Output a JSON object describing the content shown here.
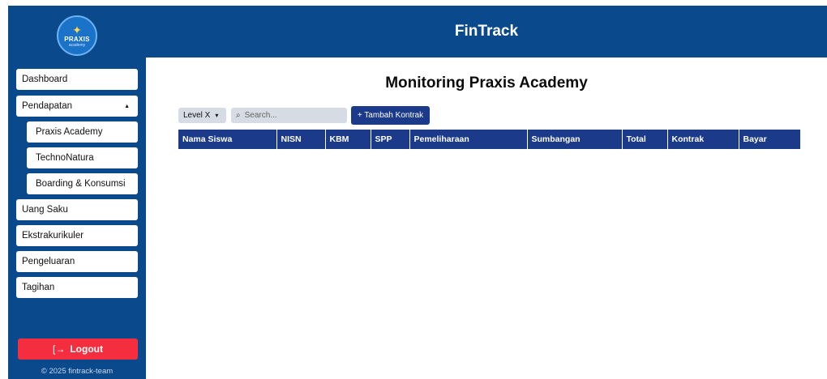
{
  "header": {
    "title": "FinTrack"
  },
  "logo": {
    "text": "PRAXIS",
    "subtext": "academy"
  },
  "sidebar": {
    "items": [
      {
        "label": "Dashboard"
      },
      {
        "label": "Pendapatan",
        "expanded": true
      },
      {
        "label": "Praxis Academy",
        "sub": true
      },
      {
        "label": "TechnoNatura",
        "sub": true
      },
      {
        "label": "Boarding & Konsumsi",
        "sub": true
      },
      {
        "label": "Uang Saku"
      },
      {
        "label": "Ekstrakurikuler"
      },
      {
        "label": "Pengeluaran"
      },
      {
        "label": "Tagihan"
      }
    ],
    "logout_label": "Logout",
    "copyright": "© 2025 fintrack-team"
  },
  "main": {
    "title": "Monitoring Praxis Academy",
    "level_select": {
      "value": "Level X"
    },
    "search": {
      "placeholder": "Search..."
    },
    "add_button": "+ Tambah Kontrak",
    "table": {
      "columns": [
        "Nama Siswa",
        "NISN",
        "KBM",
        "SPP",
        "Pemeliharaan",
        "Sumbangan",
        "Total",
        "Kontrak",
        "Bayar"
      ],
      "rows": []
    }
  },
  "colors": {
    "primary": "#0a4a8c",
    "table_header": "#1b3a8a",
    "logout": "#f52e3f",
    "input_bg": "#d7dbe4"
  },
  "icons": {
    "logout": "logout-icon",
    "search": "search-icon",
    "caret": "caret-up-icon",
    "select": "chevron-down-icon"
  }
}
